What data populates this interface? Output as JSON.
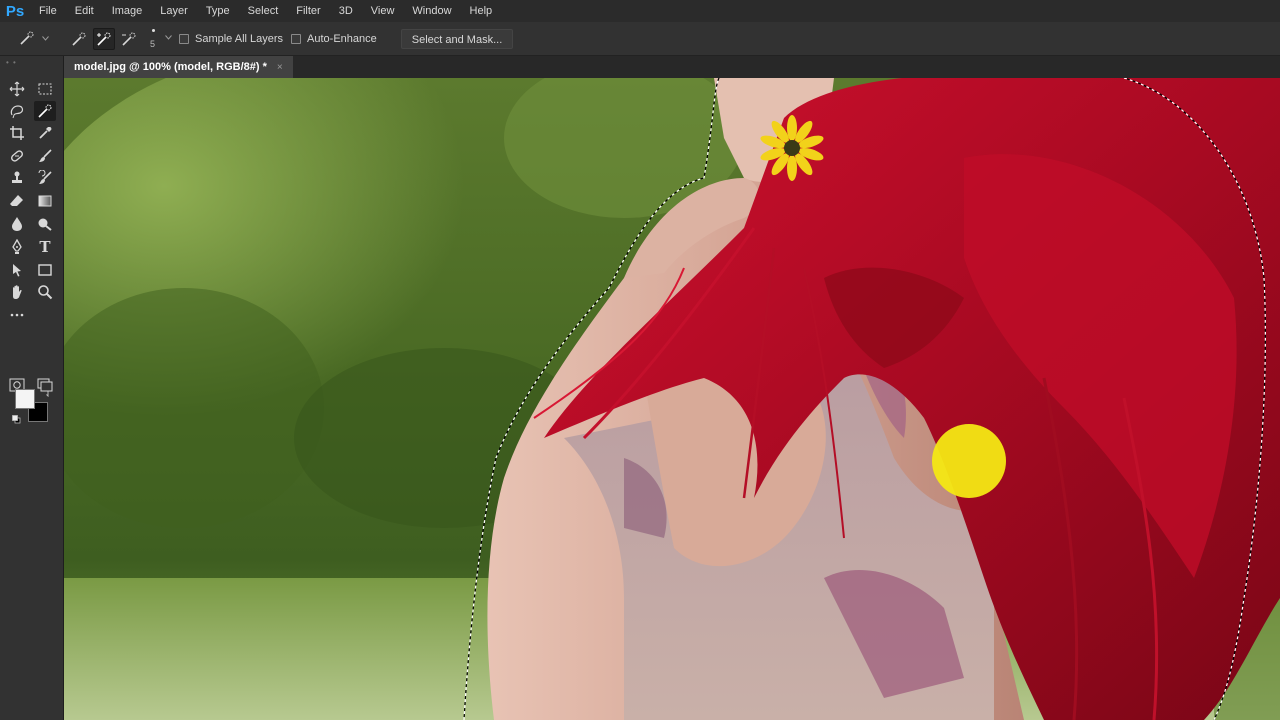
{
  "app": {
    "logo": "Ps",
    "accent_color": "#31a8ff"
  },
  "menu": {
    "items": [
      "File",
      "Edit",
      "Image",
      "Layer",
      "Type",
      "Select",
      "Filter",
      "3D",
      "View",
      "Window",
      "Help"
    ]
  },
  "options": {
    "brush_size": "5",
    "sample_all_layers_label": "Sample All Layers",
    "sample_all_layers_checked": false,
    "auto_enhance_label": "Auto-Enhance",
    "auto_enhance_checked": false,
    "select_and_mask_label": "Select and Mask..."
  },
  "document": {
    "tab_title": "model.jpg @ 100% (model, RGB/8#) *",
    "close_glyph": "×"
  },
  "toolbar": {
    "tools": [
      {
        "name": "move-tool-icon",
        "active": false
      },
      {
        "name": "marquee-tool-icon",
        "active": false
      },
      {
        "name": "lasso-tool-icon",
        "active": false
      },
      {
        "name": "quick-selection-tool-icon",
        "active": true
      },
      {
        "name": "crop-tool-icon",
        "active": false
      },
      {
        "name": "eyedropper-tool-icon",
        "active": false
      },
      {
        "name": "healing-brush-tool-icon",
        "active": false
      },
      {
        "name": "brush-tool-icon",
        "active": false
      },
      {
        "name": "clone-stamp-tool-icon",
        "active": false
      },
      {
        "name": "history-brush-tool-icon",
        "active": false
      },
      {
        "name": "eraser-tool-icon",
        "active": false
      },
      {
        "name": "gradient-tool-icon",
        "active": false
      },
      {
        "name": "blur-tool-icon",
        "active": false
      },
      {
        "name": "dodge-tool-icon",
        "active": false
      },
      {
        "name": "pen-tool-icon",
        "active": false
      },
      {
        "name": "type-tool-icon",
        "active": false
      },
      {
        "name": "path-selection-tool-icon",
        "active": false
      },
      {
        "name": "rectangle-tool-icon",
        "active": false
      },
      {
        "name": "hand-tool-icon",
        "active": false
      },
      {
        "name": "zoom-tool-icon",
        "active": false
      },
      {
        "name": "more-tools-icon",
        "active": false
      }
    ],
    "foreground_color": "#f4f4f4",
    "background_color": "#000000",
    "type_glyph": "T"
  }
}
